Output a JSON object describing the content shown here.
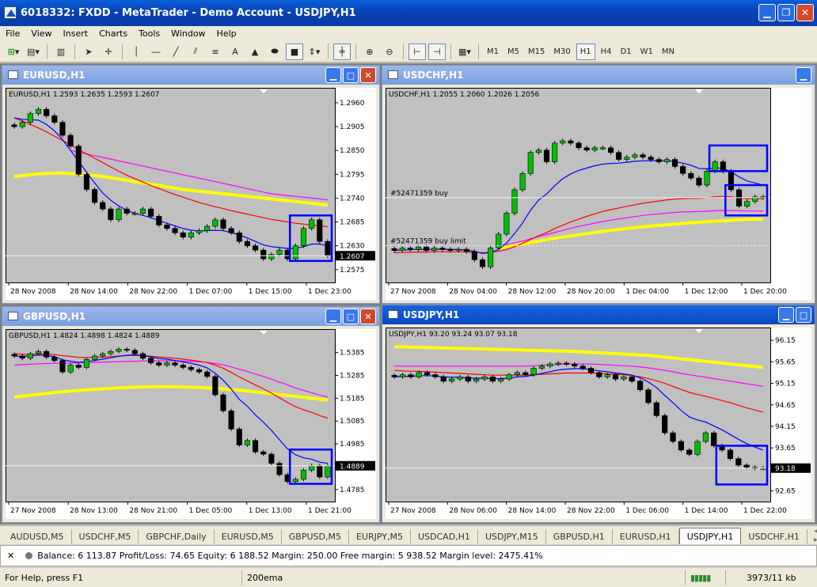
{
  "window": {
    "title": "6018332: FXDD - MetaTrader - Demo Account - USDJPY,H1"
  },
  "menu": [
    "File",
    "View",
    "Insert",
    "Charts",
    "Tools",
    "Window",
    "Help"
  ],
  "timeframes": [
    "M1",
    "M5",
    "M15",
    "M30",
    "H1",
    "H4",
    "D1",
    "W1",
    "MN"
  ],
  "active_timeframe": "H1",
  "icons": {
    "drawing": "A"
  },
  "charts": [
    {
      "window_title": "EURUSD,H1",
      "state": "inactive",
      "header": "EURUSD,H1  1.2593  1.2635  1.2593  1.2607",
      "price_ticks": [
        "1.2960",
        "1.2905",
        "1.2850",
        "1.2795",
        "1.2740",
        "1.2685",
        "1.2630",
        "1.2575"
      ],
      "current_price": "1.2607",
      "time_ticks": [
        "28 Nov 2008",
        "28 Nov 14:00",
        "28 Nov 22:00",
        "1 Dec 07:00",
        "1 Dec 15:00",
        "1 Dec 23:00"
      ],
      "ymin": 1.256,
      "ymax": 1.298,
      "closes": [
        1.2905,
        1.2915,
        1.2935,
        1.2945,
        1.293,
        1.2915,
        1.2885,
        1.286,
        1.2795,
        1.276,
        1.273,
        1.2715,
        1.269,
        1.2715,
        1.2705,
        1.2705,
        1.2715,
        1.2698,
        1.2678,
        1.267,
        1.266,
        1.265,
        1.266,
        1.2665,
        1.2675,
        1.269,
        1.267,
        1.266,
        1.264,
        1.263,
        1.262,
        1.26,
        1.261,
        1.262,
        1.26,
        1.263,
        1.267,
        1.269,
        1.264,
        1.2607
      ],
      "ema_blue": [
        1.2925,
        1.2922,
        1.2921,
        1.292,
        1.291,
        1.2895,
        1.2875,
        1.285,
        1.2825,
        1.28,
        1.2775,
        1.2752,
        1.2735,
        1.2722,
        1.2712,
        1.2705,
        1.27,
        1.2695,
        1.2688,
        1.2682,
        1.2676,
        1.267,
        1.2666,
        1.2664,
        1.2665,
        1.2666,
        1.2665,
        1.266,
        1.2655,
        1.2648,
        1.264,
        1.2632,
        1.2628,
        1.2626,
        1.2624,
        1.2624,
        1.2628,
        1.2634,
        1.2634,
        1.263
      ],
      "ema_red": [
        1.2925,
        1.2918,
        1.291,
        1.2902,
        1.2893,
        1.2883,
        1.2873,
        1.2863,
        1.2852,
        1.2842,
        1.2832,
        1.2822,
        1.2812,
        1.2802,
        1.2793,
        1.2785,
        1.2777,
        1.2769,
        1.2762,
        1.2755,
        1.2748,
        1.2742,
        1.2736,
        1.273,
        1.2725,
        1.272,
        1.2716,
        1.2711,
        1.2707,
        1.2703,
        1.2699,
        1.2695,
        1.2691,
        1.2688,
        1.2685,
        1.2682,
        1.268,
        1.2678,
        1.2676,
        1.2674
      ],
      "ema_magenta": [
        null,
        null,
        null,
        null,
        null,
        null,
        null,
        1.285,
        1.2846,
        1.2842,
        1.2838,
        1.2834,
        1.283,
        1.2826,
        1.2822,
        1.2818,
        1.2814,
        1.281,
        1.2806,
        1.2802,
        1.2798,
        1.2794,
        1.279,
        1.2786,
        1.2782,
        1.2778,
        1.2774,
        1.277,
        1.2766,
        1.2762,
        1.2758,
        1.2754,
        1.275,
        1.2748,
        1.2746,
        1.2744,
        1.2742,
        1.274,
        1.2738,
        1.2736
      ],
      "ema_yellow": [
        1.279,
        1.2792,
        1.2794,
        1.2796,
        1.2797,
        1.2798,
        1.2798,
        1.2797,
        1.2796,
        1.2794,
        1.2792,
        1.279,
        1.2787,
        1.2784,
        1.2781,
        1.2778,
        1.2775,
        1.2772,
        1.2769,
        1.2766,
        1.2763,
        1.276,
        1.2758,
        1.2756,
        1.2754,
        1.2752,
        1.275,
        1.2748,
        1.2746,
        1.2744,
        1.2742,
        1.274,
        1.2738,
        1.2736,
        1.2734,
        1.2732,
        1.273,
        1.2728,
        1.2726,
        1.2724
      ],
      "highlight_start_index": 35,
      "highlight_low": 1.2595,
      "highlight_high": 1.27,
      "order_lines": []
    },
    {
      "window_title": "USDCHF,H1",
      "state": "inactive",
      "header": "USDCHF,H1  1.2055  1.2060  1.2026  1.2056",
      "price_ticks": [],
      "current_price": "",
      "time_ticks": [
        "27 Nov 2008",
        "28 Nov 04:00",
        "28 Nov 12:00",
        "28 Nov 20:00",
        "1 Dec 04:00",
        "1 Dec 12:00",
        "1 Dec 20:00"
      ],
      "ymin": 1.172,
      "ymax": 1.25,
      "closes": [
        1.183,
        1.184,
        1.1835,
        1.1845,
        1.183,
        1.184,
        1.1835,
        1.183,
        1.1835,
        1.1825,
        1.179,
        1.176,
        1.184,
        1.19,
        1.199,
        1.209,
        1.216,
        1.225,
        1.226,
        1.221,
        1.229,
        1.23,
        1.229,
        1.227,
        1.226,
        1.227,
        1.227,
        1.225,
        1.222,
        1.223,
        1.224,
        1.223,
        1.222,
        1.221,
        1.222,
        1.219,
        1.216,
        1.214,
        1.211,
        1.217,
        1.221,
        1.217,
        1.209,
        1.202,
        1.204,
        1.206,
        1.2056
      ],
      "ema_blue": [
        1.183,
        1.1832,
        1.1833,
        1.1835,
        1.1834,
        1.1835,
        1.1835,
        1.1834,
        1.1834,
        1.1832,
        1.1826,
        1.1817,
        1.1821,
        1.1834,
        1.1862,
        1.1902,
        1.1948,
        1.2003,
        1.2046,
        1.2072,
        1.2107,
        1.2137,
        1.2158,
        1.2173,
        1.2183,
        1.2193,
        1.22,
        1.2203,
        1.2204,
        1.2208,
        1.2212,
        1.2214,
        1.2215,
        1.2214,
        1.2215,
        1.2211,
        1.2204,
        1.2195,
        1.2182,
        1.218,
        1.2184,
        1.2182,
        1.2168,
        1.2145,
        1.2128,
        1.2119,
        1.211
      ],
      "ema_red": [
        1.182,
        1.1821,
        1.1822,
        1.1823,
        1.1823,
        1.1824,
        1.1824,
        1.1824,
        1.1824,
        1.1824,
        1.1822,
        1.182,
        1.1822,
        1.1826,
        1.1834,
        1.1846,
        1.186,
        1.1877,
        1.1893,
        1.1907,
        1.1923,
        1.1938,
        1.1952,
        1.1964,
        1.1976,
        1.1987,
        1.1997,
        1.2005,
        1.2012,
        1.2019,
        1.2026,
        1.2032,
        1.2037,
        1.2042,
        1.2047,
        1.205,
        1.2052,
        1.2053,
        1.2053,
        1.2056,
        1.206,
        1.2062,
        1.206,
        1.2055,
        1.2052,
        1.2052,
        1.2052
      ],
      "ema_magenta": [
        null,
        null,
        null,
        null,
        null,
        null,
        null,
        null,
        null,
        null,
        null,
        null,
        null,
        1.185,
        1.1855,
        1.1862,
        1.187,
        1.188,
        1.189,
        1.1898,
        1.1907,
        1.1916,
        1.1925,
        1.1933,
        1.194,
        1.1947,
        1.1954,
        1.196,
        1.1965,
        1.197,
        1.1975,
        1.198,
        1.1984,
        1.1987,
        1.199,
        1.1993,
        1.1995,
        1.1996,
        1.1997,
        1.1998,
        1.2,
        1.2001,
        1.2001,
        1.2,
        1.1999,
        1.1999,
        1.1999
      ],
      "ema_yellow": [
        null,
        null,
        null,
        null,
        null,
        null,
        null,
        null,
        null,
        null,
        null,
        null,
        null,
        1.184,
        1.1846,
        1.1852,
        1.1858,
        1.1864,
        1.187,
        1.1876,
        1.1882,
        1.1887,
        1.1892,
        1.1897,
        1.1902,
        1.1907,
        1.1912,
        1.1916,
        1.192,
        1.1924,
        1.1928,
        1.1931,
        1.1934,
        1.1937,
        1.194,
        1.1943,
        1.1946,
        1.1949,
        1.1951,
        1.1953,
        1.1955,
        1.1957,
        1.1959,
        1.1961,
        1.1963,
        1.1964,
        1.1965
      ],
      "highlight_start_index": 42,
      "highlight_low": 1.198,
      "highlight_high": 1.211,
      "second_box": {
        "start_index": 40,
        "low": 1.217,
        "high": 1.228
      },
      "order_lines": [
        {
          "label": "#52471359 buy",
          "price": 1.2056
        },
        {
          "label": "#52471359 buy limit",
          "price": 1.185
        }
      ]
    },
    {
      "window_title": "GBPUSD,H1",
      "state": "inactive",
      "header": "GBPUSD,H1  1.4824  1.4898  1.4824  1.4889",
      "price_ticks": [
        "1.5385",
        "1.5285",
        "1.5185",
        "1.5085",
        "1.4985",
        "1.4885",
        "1.4785"
      ],
      "current_price": "1.4889",
      "time_ticks": [
        "27 Nov 2008",
        "28 Nov 13:00",
        "28 Nov 21:00",
        "1 Dec 05:00",
        "1 Dec 13:00",
        "1 Dec 21:00"
      ],
      "ymin": 1.476,
      "ymax": 1.546,
      "closes": [
        1.537,
        1.536,
        1.538,
        1.539,
        1.5365,
        1.535,
        1.53,
        1.533,
        1.532,
        1.5355,
        1.537,
        1.538,
        1.539,
        1.54,
        1.5395,
        1.538,
        1.536,
        1.534,
        1.533,
        1.534,
        1.533,
        1.532,
        1.531,
        1.53,
        1.528,
        1.52,
        1.513,
        1.505,
        1.498,
        1.5,
        1.495,
        1.494,
        1.49,
        1.485,
        1.482,
        1.483,
        1.487,
        1.489,
        1.484,
        1.4889
      ],
      "ema_blue": [
        1.537,
        1.5368,
        1.537,
        1.5374,
        1.5372,
        1.5367,
        1.5353,
        1.5347,
        1.5342,
        1.5345,
        1.535,
        1.5356,
        1.5362,
        1.5369,
        1.5373,
        1.5375,
        1.5372,
        1.5366,
        1.5359,
        1.5356,
        1.535,
        1.5344,
        1.5338,
        1.533,
        1.5318,
        1.5294,
        1.5264,
        1.5225,
        1.518,
        1.515,
        1.5112,
        1.508,
        1.5044,
        1.5003,
        1.4963,
        1.4937,
        1.4924,
        1.4918,
        1.4905,
        1.49
      ],
      "ema_red": [
        1.538,
        1.5378,
        1.5378,
        1.5379,
        1.5378,
        1.5376,
        1.5371,
        1.5368,
        1.5364,
        1.5363,
        1.5364,
        1.5365,
        1.5367,
        1.537,
        1.5372,
        1.5373,
        1.5372,
        1.5369,
        1.5366,
        1.5363,
        1.536,
        1.5356,
        1.5352,
        1.5347,
        1.5341,
        1.533,
        1.5316,
        1.5298,
        1.5278,
        1.5261,
        1.5243,
        1.5226,
        1.5207,
        1.5187,
        1.5166,
        1.5148,
        1.5134,
        1.5123,
        1.5109,
        1.5098
      ],
      "ema_magenta": [
        1.533,
        1.5332,
        1.5334,
        1.5336,
        1.5337,
        1.5338,
        1.5338,
        1.5339,
        1.534,
        1.5341,
        1.5342,
        1.5343,
        1.5344,
        1.5345,
        1.5346,
        1.5347,
        1.5348,
        1.5349,
        1.5349,
        1.5349,
        1.5349,
        1.5348,
        1.5347,
        1.5345,
        1.5342,
        1.5337,
        1.5331,
        1.5322,
        1.5312,
        1.5302,
        1.5291,
        1.528,
        1.5268,
        1.5256,
        1.5243,
        1.523,
        1.5219,
        1.5209,
        1.5199,
        1.519
      ],
      "ema_yellow": [
        1.519,
        1.5194,
        1.5198,
        1.5202,
        1.5206,
        1.521,
        1.5213,
        1.5216,
        1.5219,
        1.5222,
        1.5224,
        1.5226,
        1.5228,
        1.523,
        1.5232,
        1.5233,
        1.5234,
        1.5235,
        1.5235,
        1.5235,
        1.5235,
        1.5234,
        1.5233,
        1.5232,
        1.523,
        1.5228,
        1.5226,
        1.5223,
        1.522,
        1.5217,
        1.5213,
        1.5209,
        1.5205,
        1.5201,
        1.5197,
        1.5193,
        1.5189,
        1.5185,
        1.5181,
        1.5177
      ],
      "highlight_start_index": 35,
      "highlight_low": 1.481,
      "highlight_high": 1.496,
      "order_lines": []
    },
    {
      "window_title": "USDJPY,H1",
      "state": "active",
      "header": "USDJPY,H1  93.20  93.24  93.07  93.18",
      "price_ticks": [
        "96.15",
        "95.65",
        "95.15",
        "94.65",
        "94.15",
        "93.65",
        "93.15",
        "92.65"
      ],
      "current_price": "93.18",
      "time_ticks": [
        "27 Nov 2008",
        "28 Nov 06:00",
        "28 Nov 14:00",
        "28 Nov 22:00",
        "1 Dec 06:00",
        "1 Dec 14:00",
        "1 Dec 22:00"
      ],
      "ymin": 92.55,
      "ymax": 96.3,
      "closes": [
        95.3,
        95.35,
        95.3,
        95.4,
        95.35,
        95.3,
        95.2,
        95.25,
        95.3,
        95.2,
        95.25,
        95.3,
        95.2,
        95.25,
        95.35,
        95.4,
        95.35,
        95.5,
        95.55,
        95.6,
        95.62,
        95.6,
        95.55,
        95.5,
        95.4,
        95.3,
        95.35,
        95.25,
        95.3,
        95.2,
        95.0,
        94.7,
        94.4,
        94.0,
        93.8,
        93.6,
        93.5,
        93.8,
        94.0,
        93.7,
        93.6,
        93.4,
        93.25,
        93.2,
        93.18,
        93.18
      ],
      "ema_blue": [
        95.3,
        95.31,
        95.31,
        95.33,
        95.33,
        95.32,
        95.3,
        95.29,
        95.29,
        95.27,
        95.27,
        95.27,
        95.26,
        95.26,
        95.27,
        95.3,
        95.31,
        95.34,
        95.38,
        95.42,
        95.46,
        95.48,
        95.49,
        95.49,
        95.47,
        95.44,
        95.42,
        95.39,
        95.37,
        95.34,
        95.28,
        95.18,
        95.05,
        94.87,
        94.7,
        94.52,
        94.37,
        94.3,
        94.25,
        94.16,
        94.07,
        93.96,
        93.85,
        93.75,
        93.67,
        93.6
      ],
      "ema_red": [
        95.45,
        95.44,
        95.43,
        95.43,
        95.42,
        95.41,
        95.4,
        95.39,
        95.38,
        95.37,
        95.36,
        95.35,
        95.34,
        95.34,
        95.34,
        95.34,
        95.34,
        95.35,
        95.36,
        95.37,
        95.38,
        95.39,
        95.39,
        95.39,
        95.39,
        95.38,
        95.37,
        95.36,
        95.35,
        95.33,
        95.3,
        95.26,
        95.21,
        95.15,
        95.08,
        95.01,
        94.94,
        94.89,
        94.85,
        94.8,
        94.75,
        94.7,
        94.64,
        94.58,
        94.53,
        94.48
      ],
      "ema_magenta": [
        95.55,
        95.55,
        95.55,
        95.55,
        95.55,
        95.55,
        95.55,
        95.55,
        95.55,
        95.55,
        95.55,
        95.55,
        95.55,
        95.55,
        95.55,
        95.55,
        95.55,
        95.56,
        95.57,
        95.58,
        95.59,
        95.6,
        95.6,
        95.6,
        95.6,
        95.59,
        95.58,
        95.57,
        95.56,
        95.55,
        95.53,
        95.51,
        95.48,
        95.45,
        95.42,
        95.38,
        95.35,
        95.32,
        95.29,
        95.26,
        95.23,
        95.2,
        95.17,
        95.14,
        95.11,
        95.08
      ],
      "ema_yellow": [
        96.0,
        96.0,
        95.99,
        95.99,
        95.98,
        95.98,
        95.97,
        95.97,
        95.96,
        95.96,
        95.95,
        95.95,
        95.94,
        95.94,
        95.93,
        95.93,
        95.92,
        95.92,
        95.91,
        95.91,
        95.9,
        95.9,
        95.89,
        95.88,
        95.87,
        95.86,
        95.85,
        95.84,
        95.83,
        95.82,
        95.81,
        95.8,
        95.78,
        95.76,
        95.74,
        95.72,
        95.7,
        95.68,
        95.66,
        95.64,
        95.62,
        95.6,
        95.58,
        95.56,
        95.54,
        95.52
      ],
      "highlight_start_index": 40,
      "highlight_low": 92.8,
      "highlight_high": 93.7,
      "order_lines": []
    }
  ],
  "symbol_tabs": [
    "AUDUSD,M5",
    "USDCHF,M5",
    "GBPCHF,Daily",
    "EURUSD,M5",
    "GBPUSD,M5",
    "EURJPY,M5",
    "USDCAD,H1",
    "USDJPY,M15",
    "GBPUSD,H1",
    "EURUSD,H1",
    "USDJPY,H1",
    "USDCHF,H1"
  ],
  "active_symbol_tab": "USDJPY,H1",
  "terminal": {
    "text": "Balance: 6 113.87  Profit/Loss: 74.65  Equity: 6 188.52  Margin: 250.00  Free margin: 5 938.52  Margin level: 2475.41%"
  },
  "status": {
    "help": "For Help, press F1",
    "template": "200ema",
    "traffic": "3973/11 kb"
  },
  "colors": {
    "bull": "#00c000",
    "bear": "#000000",
    "ema_fast": "#0000ff",
    "ema_mid": "#ff0000",
    "ema_slow": "#ff00ff",
    "ema_200": "#ffff00",
    "box": "#0000ff",
    "chart_bg": "#c0c0c0"
  }
}
